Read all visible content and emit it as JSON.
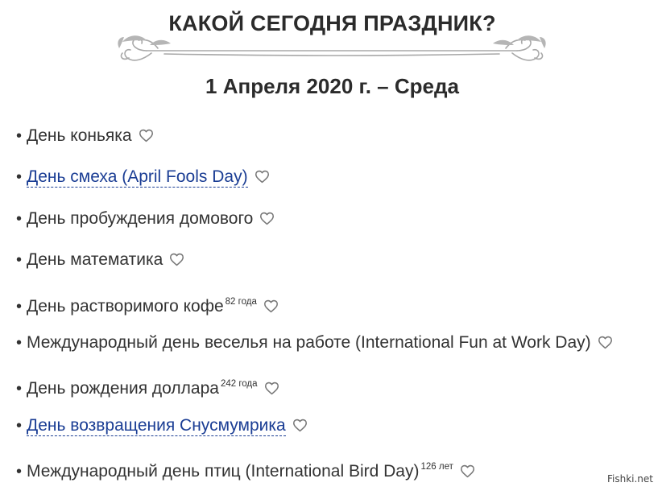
{
  "header": {
    "title": "КАКОЙ СЕГОДНЯ ПРАЗДНИК?",
    "date": "1 Апреля 2020 г. – Среда"
  },
  "bullet_symbol": "•",
  "holidays": [
    {
      "label": "День коньяка",
      "link": false,
      "note": ""
    },
    {
      "label": "День смеха (April Fools Day)",
      "link": true,
      "note": ""
    },
    {
      "label": "День пробуждения домового",
      "link": false,
      "note": ""
    },
    {
      "label": "День математика",
      "link": false,
      "note": ""
    },
    {
      "label": "День растворимого кофе",
      "link": false,
      "note": "82 года"
    },
    {
      "label": "Международный день веселья на работе (International Fun at Work Day)",
      "link": false,
      "note": ""
    },
    {
      "label": "День рождения доллара",
      "link": false,
      "note": "242 года"
    },
    {
      "label": "День возвращения Снусмумрика",
      "link": true,
      "note": ""
    },
    {
      "label": "Международный день птиц (International Bird Day)",
      "link": false,
      "note": "126 лет"
    }
  ],
  "icons": {
    "like": "heart-outline-icon",
    "divider": "ornamental-divider"
  },
  "colors": {
    "text": "#333333",
    "link": "#1a3d94",
    "heart_outline": "#777777",
    "ornament": "#a8a8a8"
  },
  "watermark": "Fishki.net"
}
